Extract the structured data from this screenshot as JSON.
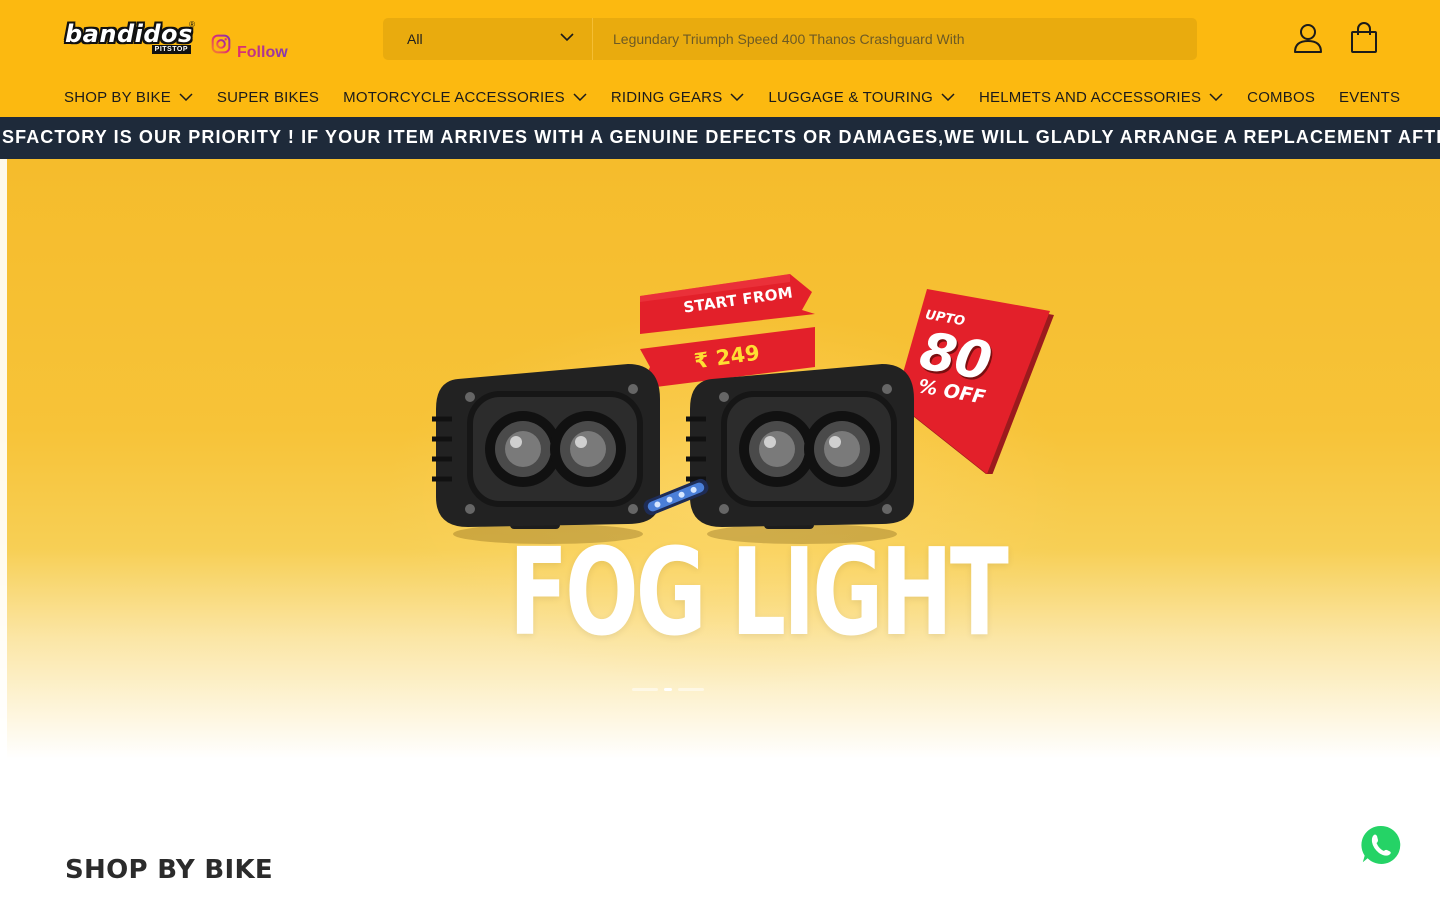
{
  "brand": {
    "logo_text": "bandidos",
    "logo_sub": "PITSTOP",
    "logo_reg": "®"
  },
  "social": {
    "follow_label": "Follow",
    "icon": "instagram-icon"
  },
  "search": {
    "category": "All",
    "placeholder": "Legundary Triumph Speed 400 Thanos Crashguard With"
  },
  "header_icons": [
    "account-icon",
    "cart-icon"
  ],
  "nav": {
    "items": [
      {
        "label": "SHOP BY BIKE",
        "has_dropdown": true
      },
      {
        "label": "SUPER BIKES",
        "has_dropdown": false
      },
      {
        "label": "MOTORCYCLE ACCESSORIES",
        "has_dropdown": true
      },
      {
        "label": "RIDING GEARS",
        "has_dropdown": true
      },
      {
        "label": "LUGGAGE & TOURING",
        "has_dropdown": true
      },
      {
        "label": "HELMETS AND ACCESSORIES",
        "has_dropdown": true
      },
      {
        "label": "COMBOS",
        "has_dropdown": false
      },
      {
        "label": "EVENTS",
        "has_dropdown": false
      }
    ]
  },
  "announcement": {
    "text": "SFACTORY IS OUR PRIORITY ! IF YOUR ITEM ARRIVES WITH A GENUINE DEFECTS OR DAMAGES,WE WILL GLADLY ARRANGE A REPLACEMENT AFTER THE SALE"
  },
  "hero": {
    "start_from": "START FROM",
    "price": "₹ 249",
    "upto": "UPTO",
    "discount": "80",
    "off": "% OFF",
    "title": "FOG LIGHT",
    "slides_total": 3,
    "active_slide": 2
  },
  "section": {
    "title": "SHOP BY BIKE"
  },
  "colors": {
    "header_bg": "#fcb910",
    "announce_bg": "#1e2a3a",
    "tag_red": "#e3202a",
    "whatsapp": "#25d366"
  },
  "floating": {
    "icon": "whatsapp-icon"
  }
}
